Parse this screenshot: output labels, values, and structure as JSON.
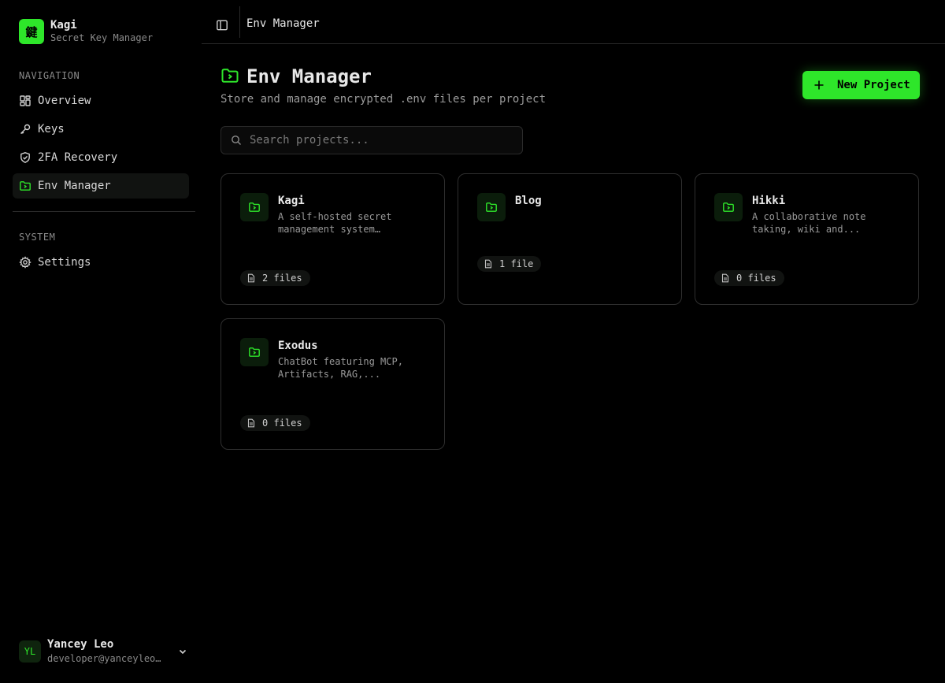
{
  "brand": {
    "logo_glyph": "鍵",
    "name": "Kagi",
    "subtitle": "Secret Key Manager"
  },
  "sidebar": {
    "navigation_label": "NAVIGATION",
    "items": [
      {
        "label": "Overview",
        "icon": "dashboard-icon"
      },
      {
        "label": "Keys",
        "icon": "key-icon"
      },
      {
        "label": "2FA Recovery",
        "icon": "shield-check-icon"
      },
      {
        "label": "Env Manager",
        "icon": "folder-icon",
        "active": true
      }
    ],
    "system_label": "SYSTEM",
    "system_items": [
      {
        "label": "Settings",
        "icon": "gear-icon"
      }
    ]
  },
  "user": {
    "initials": "YL",
    "name": "Yancey Leo",
    "email": "developer@yanceyleo.com"
  },
  "header": {
    "title": "Env Manager"
  },
  "page": {
    "title": "Env Manager",
    "subtitle": "Store and manage encrypted .env files per project",
    "new_button_label": "New Project",
    "search_placeholder": "Search projects..."
  },
  "projects": [
    {
      "name": "Kagi",
      "description": "A self-hosted secret management system for...",
      "files_label": "2 files"
    },
    {
      "name": "Blog",
      "description": "",
      "files_label": "1 file"
    },
    {
      "name": "Hikki",
      "description": "A collaborative note taking, wiki and...",
      "files_label": "0 files"
    },
    {
      "name": "Exodus",
      "description": "ChatBot featuring MCP, Artifacts, RAG,...",
      "files_label": "0 files"
    }
  ],
  "colors": {
    "accent": "#2ee62a",
    "background": "#000000",
    "border": "#2e2e2e",
    "muted_text": "#8a8a8a"
  }
}
